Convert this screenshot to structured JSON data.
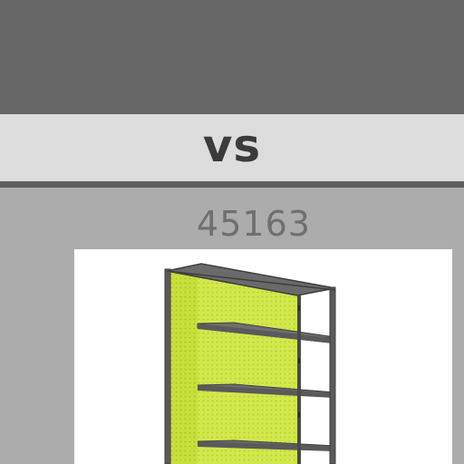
{
  "comparison": {
    "vs_label": "vs",
    "item_number": "45163"
  },
  "product": {
    "image_subject": "bookshelf-with-perforated-back",
    "colors": {
      "frame": "#5a5a5a",
      "panel": "#d2e84c",
      "panel_dots": "#b6cc2a"
    }
  },
  "colors": {
    "top_band": "#676767",
    "vs_band": "#dcdcdc",
    "divider": "#5e5e5e",
    "background": "#acacac"
  }
}
